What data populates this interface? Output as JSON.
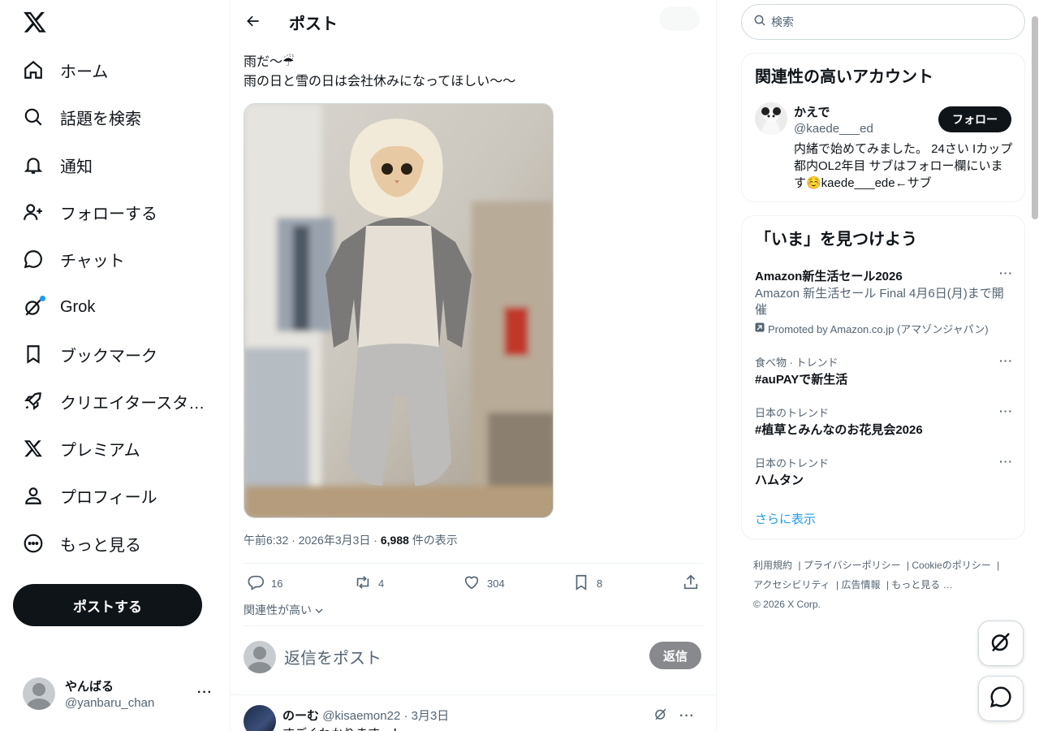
{
  "nav": {
    "items": [
      {
        "label": "ホーム",
        "icon": "home-icon"
      },
      {
        "label": "話題を検索",
        "icon": "search-icon"
      },
      {
        "label": "通知",
        "icon": "bell-icon"
      },
      {
        "label": "フォローする",
        "icon": "follow-icon"
      },
      {
        "label": "チャット",
        "icon": "chat-icon"
      },
      {
        "label": "Grok",
        "icon": "grok-icon"
      },
      {
        "label": "ブックマーク",
        "icon": "bookmark-icon"
      },
      {
        "label": "クリエイタースタ…",
        "icon": "rocket-icon"
      },
      {
        "label": "プレミアム",
        "icon": "x-premium-icon"
      },
      {
        "label": "プロフィール",
        "icon": "profile-icon"
      },
      {
        "label": "もっと見る",
        "icon": "more-circle-icon"
      }
    ],
    "post_button": "ポストする",
    "account": {
      "name": "やんばる",
      "handle": "@yanbaru_chan"
    }
  },
  "header": {
    "title": "ポスト"
  },
  "tweet": {
    "line1": "雨だ〜☔",
    "line2": "雨の日と雪の日は会社休みになってほしい〜〜",
    "time": "午前6:32 · 2026年3月3日 · ",
    "views": "6,988",
    "views_suffix": " 件の表示",
    "replies": "16",
    "reposts": "4",
    "likes": "304",
    "bookmarks": "8",
    "sort": "関連性が高い"
  },
  "reply_box": {
    "placeholder": "返信をポスト",
    "button": "返信"
  },
  "reply": {
    "name": "のーむ",
    "handle": "@kisaemon22 · 3月3日",
    "text": "すごくわかります…！"
  },
  "search": {
    "placeholder": "検索"
  },
  "suggest": {
    "title": "関連性の高いアカウント",
    "name": "かえで",
    "handle": "@kaede___ed",
    "follow": "フォロー",
    "bio": "内緒で始めてみました。 24さい Iカップ 都内OL2年目 サブはフォロー欄にいます☺️kaede___ede←サブ"
  },
  "explore": {
    "title": "「いま」を見つけよう",
    "promo": {
      "title": "Amazon新生活セール2026",
      "desc": "Amazon 新生活セール Final 4月6日(月)まで開催",
      "promoted": "Promoted by Amazon.co.jp (アマゾンジャパン)"
    },
    "trends": [
      {
        "context": "食べ物 · トレンド",
        "title": "#auPAYで新生活"
      },
      {
        "context": "日本のトレンド",
        "title": "#植草とみんなのお花見会2026"
      },
      {
        "context": "日本のトレンド",
        "title": "ハムタン"
      }
    ],
    "show_more": "さらに表示"
  },
  "footer": {
    "links": [
      "利用規約",
      "プライバシーポリシー",
      "Cookieのポリシー",
      "アクセシビリティ",
      "広告情報",
      "もっと見る …"
    ],
    "copyright": "© 2026 X Corp."
  },
  "colors": {
    "accent": "#1d9bf0",
    "text": "#0f1419",
    "muted": "#536471",
    "border": "#eff3f4"
  }
}
